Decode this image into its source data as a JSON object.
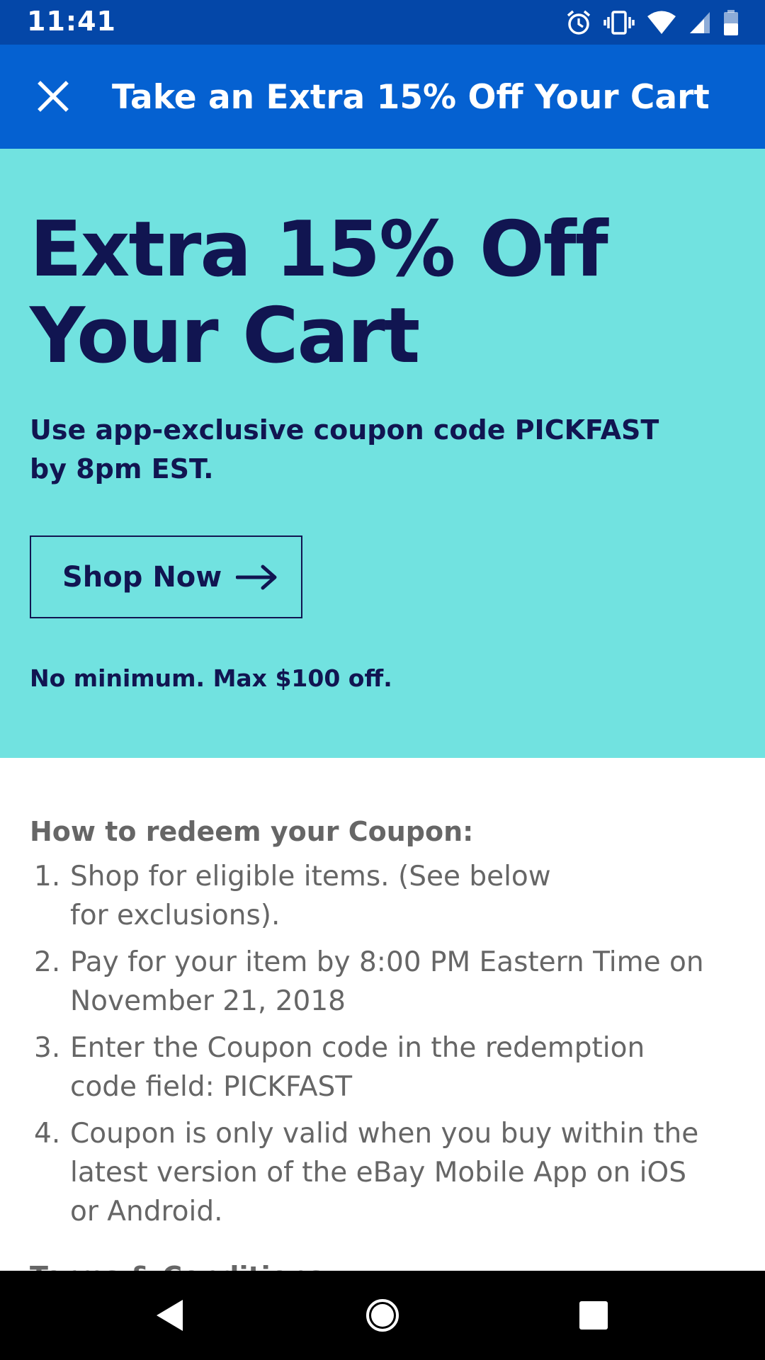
{
  "status_bar": {
    "time": "11:41",
    "icons": [
      "alarm-icon",
      "vibrate-icon",
      "wifi-icon",
      "signal-icon",
      "battery-icon"
    ],
    "background": "#0447a8"
  },
  "app_bar": {
    "title": "Take an Extra 15% Off Your Cart",
    "close_icon": "close-icon",
    "background": "#0561d1"
  },
  "hero": {
    "title_line1": "Extra 15% Off",
    "title_line2": "Your Cart",
    "subtitle_line1": "Use app-exclusive coupon code PICKFAST",
    "subtitle_line2": "by 8pm EST.",
    "cta_label": "Shop Now",
    "cta_icon": "arrow-right-icon",
    "note": "No minimum. Max $100 off.",
    "background": "#71e2e0",
    "text_color": "#111551"
  },
  "redeem": {
    "heading": "How to redeem your Coupon:",
    "steps": [
      {
        "num": "1.",
        "line1": "Shop for eligible items. (See below",
        "line2": "for exclusions).",
        "line3": ""
      },
      {
        "num": "2.",
        "line1": "Pay for your item by 8:00 PM Eastern Time on",
        "line2": "November 21, 2018",
        "line3": ""
      },
      {
        "num": "3.",
        "line1": "Enter the Coupon code in the redemption",
        "line2": "code field: PICKFAST",
        "line3": ""
      },
      {
        "num": "4.",
        "line1": "Coupon is only valid when you buy within the",
        "line2": "latest version of the eBay Mobile App on iOS",
        "line3": "or Android."
      }
    ],
    "next_heading": "Terms & Conditions"
  },
  "nav_bar": {
    "icons": [
      "back-icon",
      "home-icon",
      "recents-icon"
    ]
  }
}
